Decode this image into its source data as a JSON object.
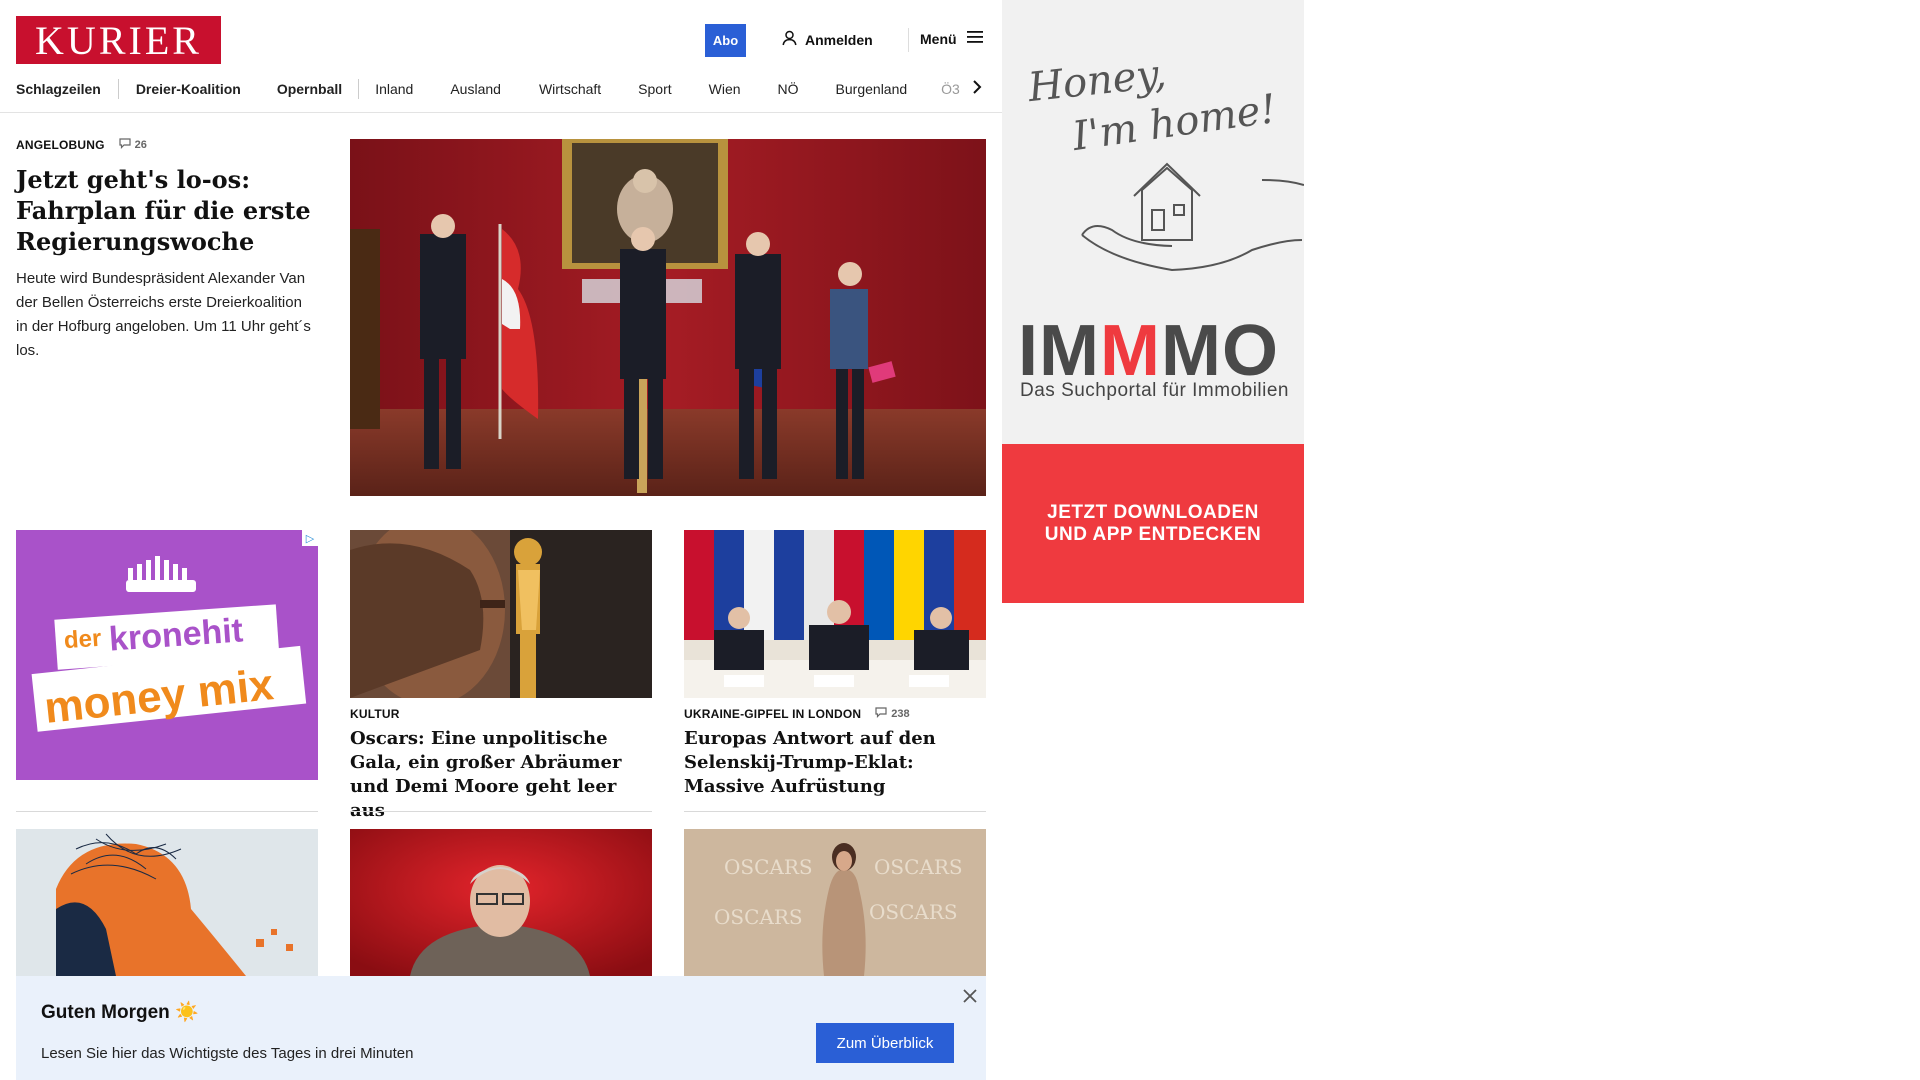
{
  "header": {
    "logo_text": "KURIER",
    "abo_label": "Abo",
    "login_label": "Anmelden",
    "menu_label": "Menü",
    "brand_color": "#c8102e",
    "accent_color": "#2a5fd6"
  },
  "nav": {
    "items": [
      {
        "label": "Schlagzeilen",
        "bold": true
      },
      {
        "label": "Dreier-Koalition",
        "bold": true
      },
      {
        "label": "Opernball",
        "bold": true
      },
      {
        "label": "Inland",
        "bold": false
      },
      {
        "label": "Ausland",
        "bold": false
      },
      {
        "label": "Wirtschaft",
        "bold": false
      },
      {
        "label": "Sport",
        "bold": false
      },
      {
        "label": "Wien",
        "bold": false
      },
      {
        "label": "NÖ",
        "bold": false
      },
      {
        "label": "Burgenland",
        "bold": false
      },
      {
        "label": "Ö3",
        "bold": false
      }
    ],
    "next_icon": "chevron-right-icon"
  },
  "lead": {
    "kicker": "ANGELOBUNG",
    "comments": "26",
    "title": "Jetzt geht's lo-os: Fahrplan für die erste Regierungswoche",
    "description": "Heute wird Bundespräsident Alexander Van der Bellen Österreichs erste Dreierkoalition in der Hofburg angeloben. Um 11 Uhr geht´s los."
  },
  "ads": {
    "kronehit": {
      "line1": "der",
      "line2": "kronehit",
      "line3": "money mix"
    },
    "immmo": {
      "tagline_1": "Honey,",
      "tagline_2": "I'm home!",
      "brand": "IMMMO",
      "subtitle": "Das Suchportal für Immobilien",
      "cta_line1": "JETZT DOWNLOADEN",
      "cta_line2": "UND APP ENTDECKEN"
    }
  },
  "cards": [
    {
      "kicker": "KULTUR",
      "comments": "",
      "title": "Oscars: Eine unpolitische Gala, ein großer Abräumer und Demi Moore geht leer aus"
    },
    {
      "kicker": "UKRAINE-GIPFEL IN LONDON",
      "comments": "238",
      "title": "Europas Antwort auf den Selenskij-Trump-Eklat: Massive Aufrüstung"
    }
  ],
  "banner": {
    "title": "Guten Morgen",
    "emoji": "☀️",
    "text": "Lesen Sie hier das Wichtigste des Tages in drei Minuten",
    "button": "Zum Überblick"
  }
}
